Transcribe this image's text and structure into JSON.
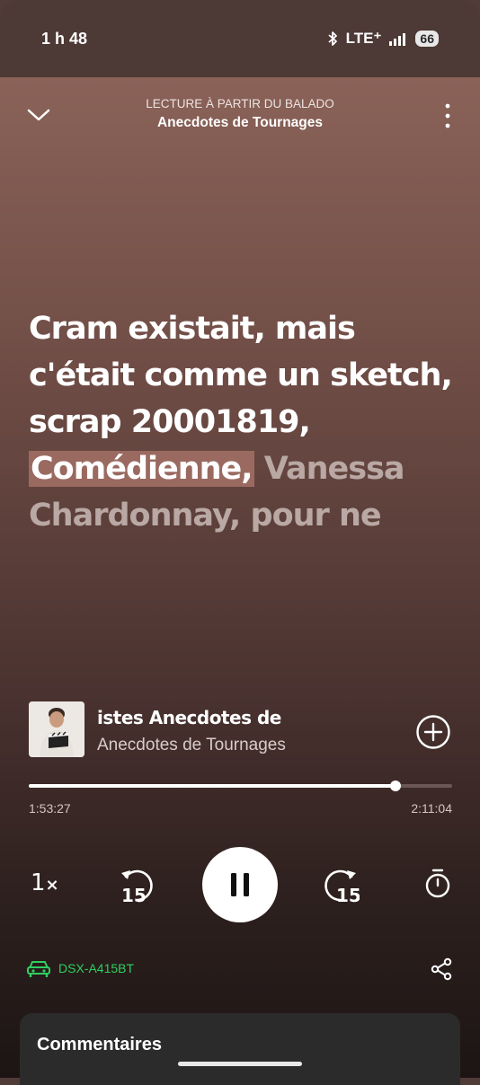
{
  "status": {
    "time": "1 h 48",
    "network": "LTE⁺",
    "battery": "66"
  },
  "header": {
    "context_label": "LECTURE À PARTIR DU BALADO",
    "context_title": "Anecdotes de Tournages"
  },
  "lyrics": {
    "played": "Cram existait, mais c'était comme un sketch, scrap 20001819,",
    "current": "Comédienne,",
    "upcoming": "Vanessa Chardonnay, pour ne"
  },
  "now_playing": {
    "title": "istes                 Anecdotes de",
    "subtitle": "Anecdotes de Tournages"
  },
  "progress": {
    "elapsed": "1:53:27",
    "total": "2:11:04",
    "fraction": 0.866
  },
  "controls": {
    "speed": "1",
    "speed_suffix": "×",
    "rewind_seconds": "15",
    "forward_seconds": "15"
  },
  "device": {
    "name": "DSX-A415BT",
    "color": "#2fcf5f"
  },
  "comments": {
    "title": "Commentaires"
  },
  "icons": [
    "bluetooth-icon",
    "signal-icon",
    "battery-icon",
    "chevron-down-icon",
    "more-icon",
    "add-circle-icon",
    "rewind-15-icon",
    "pause-icon",
    "forward-15-icon",
    "sleep-timer-icon",
    "car-icon",
    "share-icon"
  ]
}
